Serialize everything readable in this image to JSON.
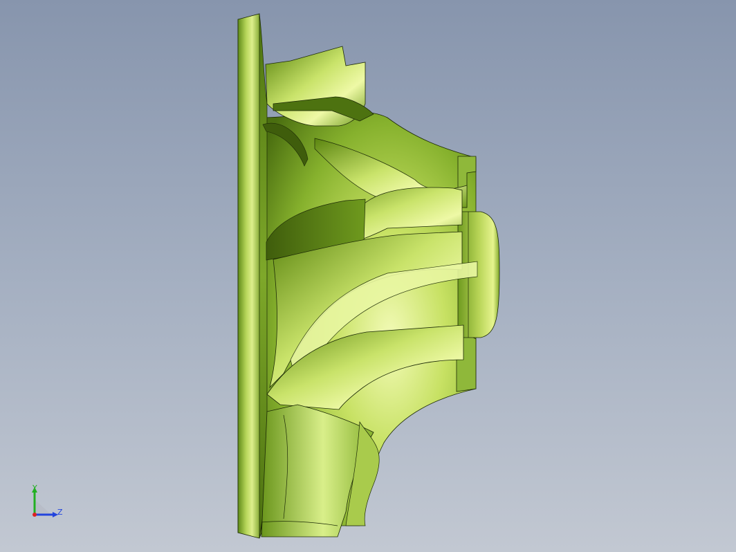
{
  "viewport": {
    "background_top": "#8795ad",
    "background_bottom": "#c2c8d2"
  },
  "model": {
    "part": "impeller",
    "color_highlight": "#ecf9a0",
    "color_base": "#7aa62a",
    "color_shadow": "#3e5a0e",
    "edge_color": "#1c2a06"
  },
  "triad": {
    "y_label": "Y",
    "z_label": "Z",
    "y_color": "#22b022",
    "z_color": "#2244dd",
    "x_color": "#dd2222"
  }
}
